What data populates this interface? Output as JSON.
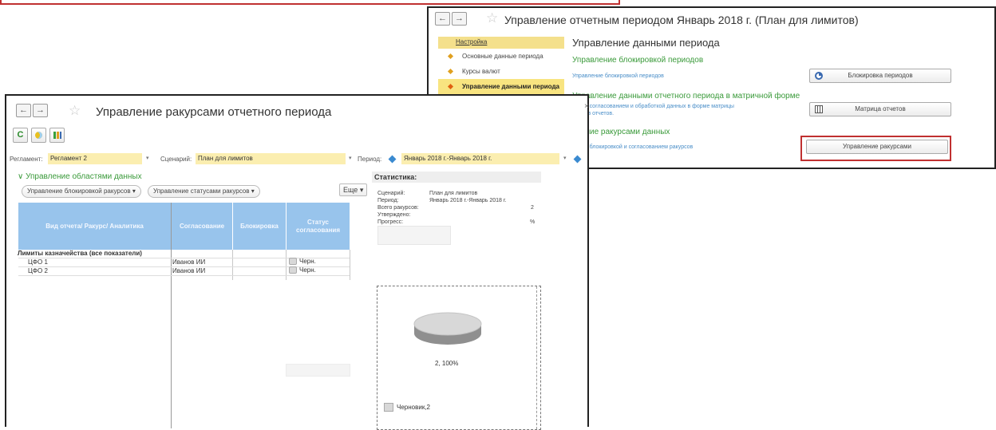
{
  "back_window": {
    "title": "Управление отчетным периодом Январь 2018 г. (План для лимитов)",
    "sidebar": {
      "header": "Настройка",
      "items": [
        "Основные данные периода",
        "Курсы валют",
        "Управление данными периода"
      ]
    },
    "heading": "Управление данными периода",
    "sections": [
      {
        "title": "Управление блокировкой периодов",
        "desc": "Управление блокировкой периодов",
        "button": "Блокировка периодов"
      },
      {
        "title": "Управление данными отчетного периода в матричной форме",
        "desc_line1": "ление согласованием и обработкой данных в форме матрицы",
        "desc_line2": "пляров отчетов.",
        "button": "Матрица отчетов"
      },
      {
        "title": "вление ракурсами данных",
        "desc": "ление блокировкой и согласованием ракурсов",
        "button": "Управление ракурсами"
      }
    ]
  },
  "front_window": {
    "title": "Управление ракурсами отчетного периода",
    "filters": {
      "reglament_label": "Регламент:",
      "reglament_value": "Регламент 2",
      "scenario_label": "Сценарий:",
      "scenario_value": "План для лимитов",
      "period_label": "Период:",
      "period_value": "Январь 2018 г.-Январь 2018 г."
    },
    "group_title": "Управление областями данных",
    "buttons": {
      "lock_mgmt": "Управление блокировкой ракурсов",
      "status_mgmt": "Управление статусами ракурсов",
      "more": "Еще"
    },
    "table": {
      "headers": [
        "Вид отчета/ Ракурс/ Аналитика",
        "Согласование",
        "Блокировка",
        "Статус согласования"
      ],
      "group_row": "Лимиты казначейства (все показатели)",
      "rows": [
        {
          "name": "ЦФО 1",
          "approver": "Иванов ИИ",
          "status": "Черн."
        },
        {
          "name": "ЦФО 2",
          "approver": "Иванов ИИ",
          "status": "Черн."
        }
      ]
    },
    "stats": {
      "title": "Статистика:",
      "rows": [
        {
          "k": "Сценарий:",
          "v": "План для лимитов"
        },
        {
          "k": "Период:",
          "v": "Январь 2018 г.-Январь 2018 г."
        },
        {
          "k": "Всего ракурсов:",
          "v": "2"
        },
        {
          "k": "Утверждено:",
          "v": ""
        },
        {
          "k": "Прогресс:",
          "v": "%"
        }
      ]
    },
    "chart_data": {
      "type": "pie",
      "series": [
        {
          "name": "Черновик",
          "values": [
            2
          ]
        }
      ],
      "categories": [
        "Черновик"
      ],
      "data_label": "2, 100%",
      "legend_label": "Черновик,2",
      "colors": [
        "#d8d8d8"
      ]
    }
  }
}
